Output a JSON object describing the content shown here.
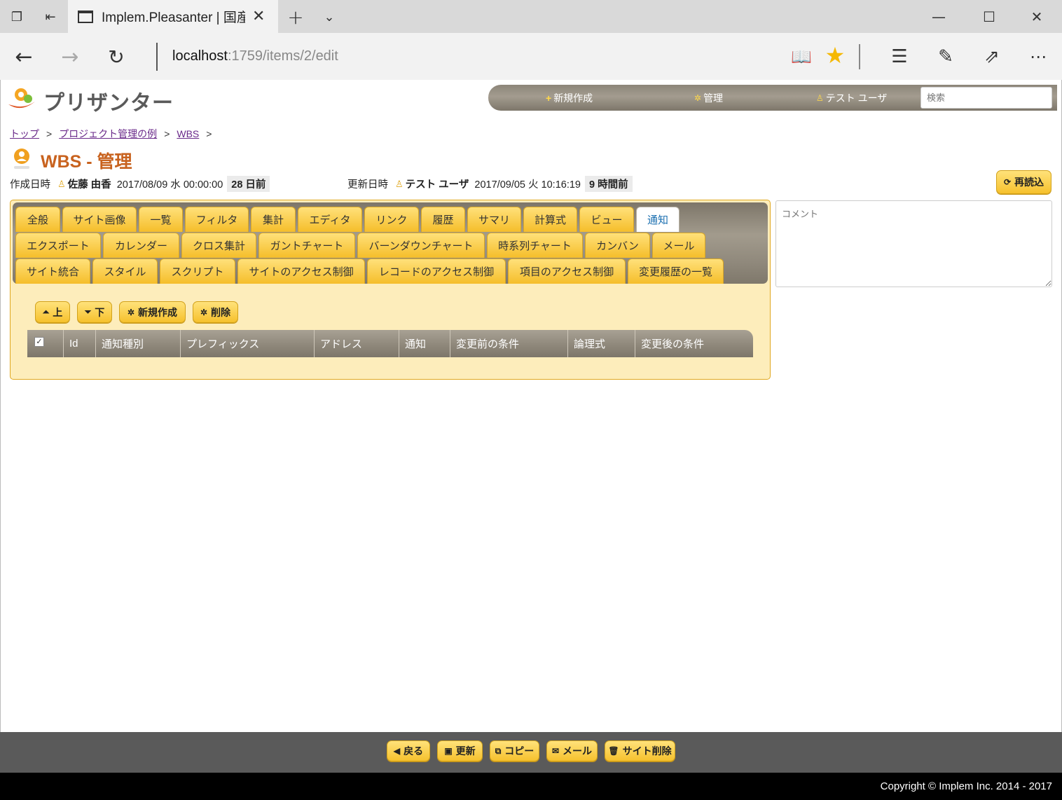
{
  "browser": {
    "tab_title": "Implem.Pleasanter | 国産",
    "url_host": "localhost",
    "url_rest": ":1759/items/2/edit"
  },
  "header": {
    "logo_text": "プリザンター",
    "nav": {
      "new_label": "新規作成",
      "admin_label": "管理",
      "user_label": "テスト ユーザ"
    },
    "search_placeholder": "検索"
  },
  "breadcrumb": [
    "トップ",
    "プロジェクト管理の例",
    "WBS"
  ],
  "title": "WBS - 管理",
  "meta": {
    "created_label": "作成日時",
    "created_user": "佐藤 由香",
    "created_at": "2017/08/09 水 00:00:00",
    "created_ago": "28 日前",
    "updated_label": "更新日時",
    "updated_user": "テスト ユーザ",
    "updated_at": "2017/09/05 火 10:16:19",
    "updated_ago": "9 時間前",
    "reload_label": "再読込"
  },
  "tabs": [
    [
      "全般",
      "サイト画像",
      "一覧",
      "フィルタ",
      "集計",
      "エディタ",
      "リンク",
      "履歴",
      "サマリ",
      "計算式",
      "ビュー",
      "通知"
    ],
    [
      "エクスポート",
      "カレンダー",
      "クロス集計",
      "ガントチャート",
      "バーンダウンチャート",
      "時系列チャート",
      "カンバン",
      "メール"
    ],
    [
      "サイト統合",
      "スタイル",
      "スクリプト",
      "サイトのアクセス制御",
      "レコードのアクセス制御",
      "項目のアクセス制御",
      "変更履歴の一覧"
    ]
  ],
  "active_tab": "通知",
  "toolbar": {
    "up_label": "上",
    "down_label": "下",
    "new_label": "新規作成",
    "delete_label": "削除"
  },
  "grid_columns": [
    "Id",
    "通知種別",
    "プレフィックス",
    "アドレス",
    "通知",
    "変更前の条件",
    "論理式",
    "変更後の条件"
  ],
  "comment_placeholder": "コメント",
  "footer": {
    "back_label": "戻る",
    "update_label": "更新",
    "copy_label": "コピー",
    "mail_label": "メール",
    "delete_site_label": "サイト削除",
    "copyright": "Copyright © Implem Inc. 2014 - 2017"
  }
}
